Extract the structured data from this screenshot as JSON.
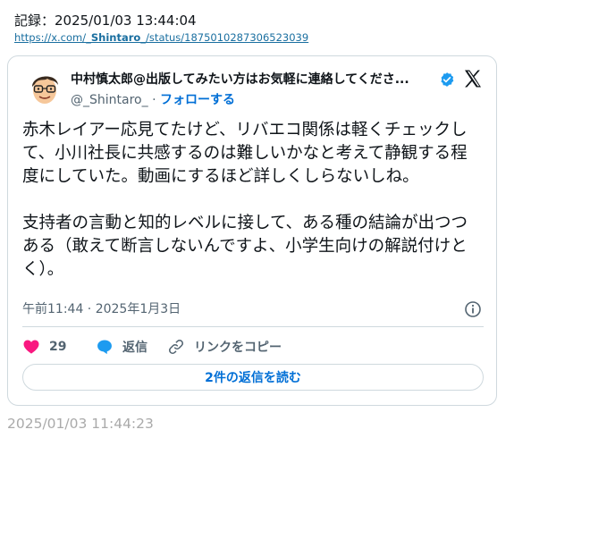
{
  "record": {
    "label": "記録：2025/01/03 13:44:04"
  },
  "link": {
    "prefix": "https://x.com/",
    "user": "_Shintaro_",
    "suffix": "/status/1875010287306523039"
  },
  "tweet": {
    "display_name": "中村慎太郎@出版してみたい方はお気軽に連絡してくださ...",
    "handle": "@_Shintaro_",
    "separator": "·",
    "follow_label": "フォローする",
    "text": "赤木レイアー応見てたけど、リバエコ関係は軽くチェックして、小川社長に共感するのは難しいかなと考えて静観する程度にしていた。動画にするほど詳しくしらないしね。\n\n支持者の言動と知的レベルに接して、ある種の結論が出つつある（敢えて断言しないんですよ、小学生向けの解説付けとく）。",
    "timestamp": "午前11:44 · 2025年1月3日",
    "like_count": "29",
    "reply_label": "返信",
    "copy_link_label": "リンクをコピー",
    "read_replies_label": "2件の返信を読む"
  },
  "footer": {
    "captured_time": "2025/01/03 11:44:23"
  },
  "icons": [
    "avatar",
    "verified-badge-icon",
    "x-logo-icon",
    "info-icon",
    "heart-icon",
    "reply-icon",
    "link-icon"
  ],
  "colors": {
    "link": "#006fd6",
    "heart": "#f91880",
    "reply": "#1d9bf0",
    "muted": "#536471",
    "border": "#cfd9de"
  }
}
